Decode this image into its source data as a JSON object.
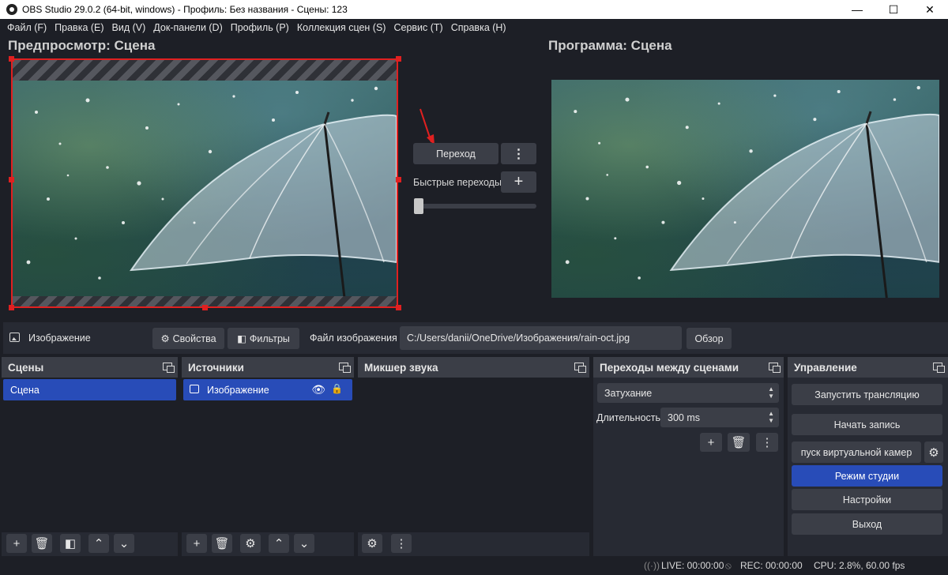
{
  "window": {
    "title": "OBS Studio 29.0.2 (64-bit, windows) - Профиль: Без названия - Сцены: 123",
    "minimize": "—",
    "maximize": "☐",
    "close": "✕"
  },
  "menu": [
    "Файл (F)",
    "Правка (E)",
    "Вид (V)",
    "Док-панели (D)",
    "Профиль (P)",
    "Коллекция сцен (S)",
    "Сервис (T)",
    "Справка (H)"
  ],
  "preview": {
    "title": "Предпросмотр: Сцена"
  },
  "program": {
    "title": "Программа: Сцена"
  },
  "transition": {
    "button_label": "Переход",
    "menu_glyph": "⋮",
    "quick_label": "Быстрые переходы",
    "add_glyph": "+",
    "tbar_value": 0
  },
  "source_toolbar": {
    "source_name": "Изображение",
    "properties_label": "Свойства",
    "filters_label": "Фильтры",
    "file_label": "Файл изображения",
    "file_path": "C:/Users/danii/OneDrive/Изображения/rain-oct.jpg",
    "browse_label": "Обзор"
  },
  "docks": {
    "scenes": {
      "title": "Сцены",
      "items": [
        "Сцена"
      ]
    },
    "sources": {
      "title": "Источники",
      "items": [
        "Изображение"
      ]
    },
    "mixer": {
      "title": "Микшер звука"
    },
    "transitions": {
      "title": "Переходы между сценами",
      "selected": "Затухание",
      "duration_label": "Длительность",
      "duration_value": "300 ms"
    },
    "controls": {
      "title": "Управление",
      "buttons": [
        "Запустить трансляцию",
        "Начать запись",
        "пуск виртуальной камер",
        "Режим студии",
        "Настройки",
        "Выход"
      ]
    }
  },
  "statusbar": {
    "live": "LIVE: 00:00:00",
    "rec": "REC: 00:00:00",
    "cpu": "CPU: 2.8%, 60.00 fps"
  },
  "colors": {
    "background": "#1d1f26",
    "panel": "#272a33",
    "button": "#3b3e47",
    "selection": "#284cb8",
    "preview_border": "#e02020"
  }
}
